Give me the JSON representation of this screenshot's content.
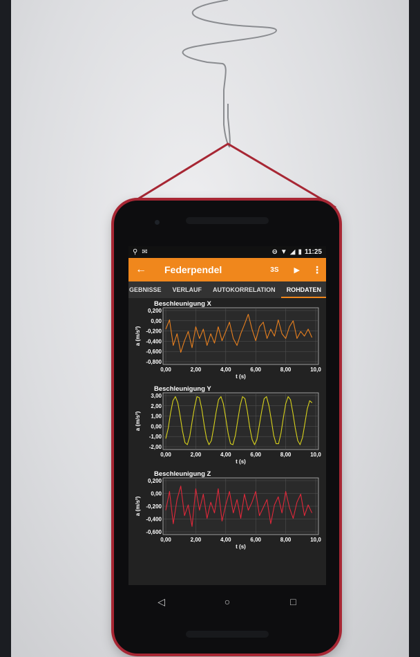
{
  "statusbar": {
    "left_icons": [
      "location-icon",
      "mail-icon"
    ],
    "time": "11:25",
    "right_icons": [
      "do-not-disturb-icon",
      "wifi-icon",
      "signal-icon",
      "battery-icon"
    ]
  },
  "appbar": {
    "back_icon": "arrow-left-icon",
    "title": "Federpendel",
    "duration": "3S",
    "play_icon": "play-icon",
    "menu_icon": "more-vertical-icon",
    "color": "#f0871c"
  },
  "tabs": [
    {
      "label": "GEBNISSE",
      "active": false
    },
    {
      "label": "VERLAUF",
      "active": false
    },
    {
      "label": "AUTOKORRELATION",
      "active": false
    },
    {
      "label": "ROHDATEN",
      "active": true
    }
  ],
  "navbar": {
    "back_icon": "triangle-back-icon",
    "home_icon": "circle-home-icon",
    "recents_icon": "square-recents-icon"
  },
  "chart_data": [
    {
      "type": "line",
      "title": "Beschleunigung X",
      "xlabel": "t (s)",
      "ylabel": "a (m/s²)",
      "color": "#e8801f",
      "xlim": [
        0,
        10
      ],
      "ylim": [
        -0.8,
        0.3
      ],
      "xticks": [
        "0,00",
        "2,00",
        "4,00",
        "6,00",
        "8,00",
        "10,0"
      ],
      "yticks": [
        "0,200",
        "0,00",
        "-0,200",
        "-0,400",
        "-0,600",
        "-0,800"
      ],
      "x": [
        0.0,
        0.25,
        0.5,
        0.75,
        1.0,
        1.25,
        1.5,
        1.75,
        2.0,
        2.25,
        2.5,
        2.75,
        3.0,
        3.25,
        3.5,
        3.75,
        4.0,
        4.25,
        4.5,
        4.75,
        5.0,
        5.25,
        5.5,
        5.75,
        6.0,
        6.25,
        6.5,
        6.75,
        7.0,
        7.25,
        7.5,
        7.75,
        8.0,
        8.25,
        8.5,
        8.75,
        9.0,
        9.25,
        9.5,
        9.75
      ],
      "y": [
        -0.1,
        0.1,
        -0.45,
        -0.2,
        -0.6,
        -0.35,
        -0.15,
        -0.5,
        -0.05,
        -0.3,
        -0.1,
        -0.45,
        -0.2,
        -0.4,
        -0.05,
        -0.35,
        -0.15,
        0.05,
        -0.3,
        -0.45,
        -0.2,
        0.0,
        0.22,
        -0.1,
        -0.35,
        -0.05,
        0.05,
        -0.3,
        -0.1,
        -0.25,
        0.1,
        -0.2,
        -0.3,
        -0.05,
        0.08,
        -0.3,
        -0.15,
        -0.25,
        -0.1,
        -0.28
      ]
    },
    {
      "type": "line",
      "title": "Beschleunigung Y",
      "xlabel": "t (s)",
      "ylabel": "a (m/s²)",
      "color": "#d8d21c",
      "xlim": [
        0,
        10
      ],
      "ylim": [
        -2.0,
        3.0
      ],
      "xticks": [
        "0,00",
        "2,00",
        "4,00",
        "6,00",
        "8,00",
        "10,0"
      ],
      "yticks": [
        "3,00",
        "2,00",
        "1,00",
        "0,00",
        "-1,00",
        "-2,00"
      ],
      "x": [
        0.0,
        0.16,
        0.32,
        0.48,
        0.64,
        0.8,
        0.96,
        1.12,
        1.28,
        1.44,
        1.6,
        1.76,
        1.92,
        2.08,
        2.24,
        2.4,
        2.56,
        2.72,
        2.88,
        3.04,
        3.2,
        3.36,
        3.52,
        3.68,
        3.84,
        4.0,
        4.16,
        4.32,
        4.48,
        4.64,
        4.8,
        4.96,
        5.12,
        5.28,
        5.44,
        5.6,
        5.76,
        5.92,
        6.08,
        6.24,
        6.4,
        6.56,
        6.72,
        6.88,
        7.04,
        7.2,
        7.36,
        7.52,
        7.68,
        7.84,
        8.0,
        8.16,
        8.32,
        8.48,
        8.64,
        8.8,
        8.96,
        9.12,
        9.28,
        9.44,
        9.6,
        9.76
      ],
      "y": [
        -1.2,
        -0.2,
        1.3,
        2.5,
        2.9,
        2.3,
        1.0,
        -0.5,
        -1.6,
        -1.8,
        -1.0,
        0.5,
        1.9,
        2.9,
        2.8,
        1.7,
        0.1,
        -1.2,
        -1.8,
        -1.4,
        -0.1,
        1.4,
        2.6,
        2.9,
        2.2,
        0.8,
        -0.7,
        -1.7,
        -1.8,
        -0.9,
        0.6,
        2.0,
        2.9,
        2.7,
        1.5,
        -0.1,
        -1.3,
        -1.8,
        -1.3,
        0.1,
        1.5,
        2.7,
        2.9,
        2.0,
        0.6,
        -0.9,
        -1.7,
        -1.7,
        -0.7,
        0.8,
        2.2,
        2.9,
        2.6,
        1.3,
        -0.2,
        -1.4,
        -1.8,
        -1.1,
        0.3,
        1.7,
        2.5,
        2.3
      ]
    },
    {
      "type": "line",
      "title": "Beschleunigung Z",
      "xlabel": "t (s)",
      "ylabel": "a (m/s²)",
      "color": "#e0283a",
      "xlim": [
        0,
        10
      ],
      "ylim": [
        -0.7,
        0.25
      ],
      "xticks": [
        "0,00",
        "2,00",
        "4,00",
        "6,00",
        "8,00",
        "10,0"
      ],
      "yticks": [
        "0,200",
        "0,00",
        "-0,200",
        "-0,400",
        "-0,600"
      ],
      "x": [
        0.0,
        0.25,
        0.5,
        0.75,
        1.0,
        1.25,
        1.5,
        1.75,
        2.0,
        2.25,
        2.5,
        2.75,
        3.0,
        3.25,
        3.5,
        3.75,
        4.0,
        4.25,
        4.5,
        4.75,
        5.0,
        5.25,
        5.5,
        5.75,
        6.0,
        6.25,
        6.5,
        6.75,
        7.0,
        7.25,
        7.5,
        7.75,
        8.0,
        8.25,
        8.5,
        8.75,
        9.0,
        9.25,
        9.5,
        9.75
      ],
      "y": [
        -0.3,
        0.05,
        -0.55,
        -0.1,
        0.15,
        -0.4,
        -0.2,
        -0.6,
        0.1,
        -0.3,
        0.0,
        -0.45,
        -0.15,
        -0.35,
        0.1,
        -0.5,
        -0.2,
        0.05,
        -0.35,
        -0.1,
        -0.45,
        0.0,
        -0.3,
        -0.15,
        0.05,
        -0.4,
        -0.25,
        -0.1,
        -0.55,
        -0.2,
        -0.05,
        -0.35,
        0.05,
        -0.25,
        -0.45,
        -0.15,
        0.0,
        -0.4,
        -0.2,
        -0.35
      ]
    }
  ]
}
